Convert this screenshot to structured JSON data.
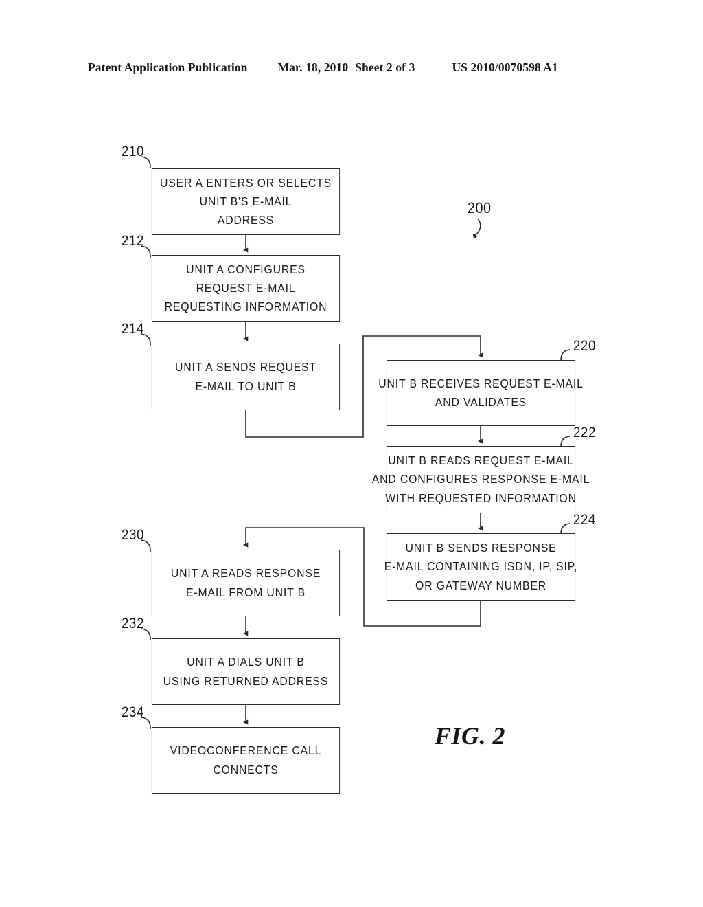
{
  "header": {
    "publication": "Patent Application Publication",
    "date": "Mar. 18, 2010",
    "sheet": "Sheet 2 of 3",
    "patent_number": "US 2010/0070598 A1"
  },
  "figure": {
    "caption": "FIG. 2",
    "diagram_ref": "200",
    "nodes": [
      {
        "ref": "210",
        "lines": [
          "USER A ENTERS OR SELECTS",
          "UNIT B'S E-MAIL",
          "ADDRESS"
        ]
      },
      {
        "ref": "212",
        "lines": [
          "UNIT A CONFIGURES",
          "REQUEST E-MAIL",
          "REQUESTING INFORMATION"
        ]
      },
      {
        "ref": "214",
        "lines": [
          "UNIT A SENDS REQUEST",
          "E-MAIL TO UNIT B"
        ]
      },
      {
        "ref": "220",
        "lines": [
          "UNIT B RECEIVES REQUEST E-MAIL",
          "AND VALIDATES"
        ]
      },
      {
        "ref": "222",
        "lines": [
          "UNIT B READS REQUEST E-MAIL",
          "AND CONFIGURES RESPONSE E-MAIL",
          "WITH REQUESTED INFORMATION"
        ]
      },
      {
        "ref": "224",
        "lines": [
          "UNIT B SENDS RESPONSE",
          "E-MAIL CONTAINING ISDN, IP, SIP,",
          "OR GATEWAY NUMBER"
        ]
      },
      {
        "ref": "230",
        "lines": [
          "UNIT A READS RESPONSE",
          "E-MAIL FROM UNIT B"
        ]
      },
      {
        "ref": "232",
        "lines": [
          "UNIT A DIALS UNIT B",
          "USING RETURNED ADDRESS"
        ]
      },
      {
        "ref": "234",
        "lines": [
          "VIDEOCONFERENCE CALL",
          "CONNECTS"
        ]
      }
    ],
    "ink_color": "#1b1b1b",
    "background_color": "#ffffff"
  }
}
